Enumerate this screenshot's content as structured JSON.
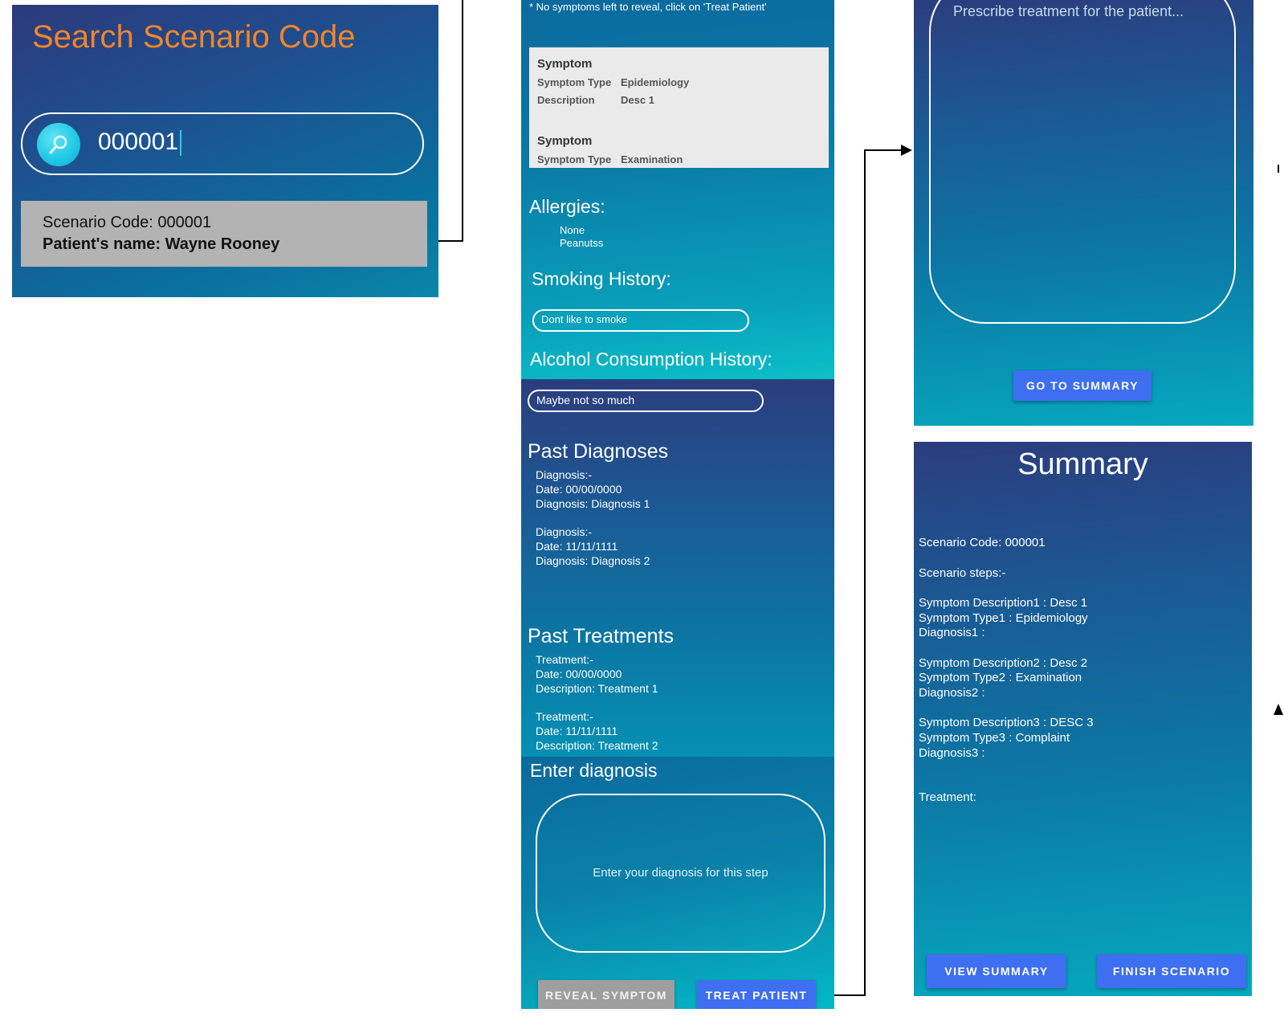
{
  "search_screen": {
    "title": "Search Scenario Code",
    "search_value": "000001",
    "result": {
      "code_line": "Scenario Code:  000001",
      "name_line": "Patient's name:  Wayne Rooney"
    }
  },
  "patient_screen": {
    "note": "* No symptoms left to reveal, click on 'Treat Patient'",
    "symptoms": [
      {
        "heading": "Symptom",
        "type_label": "Symptom Type",
        "type_value": "Epidemiology",
        "desc_label": "Description",
        "desc_value": "Desc 1"
      },
      {
        "heading": "Symptom",
        "type_label": "Symptom Type",
        "type_value": "Examination"
      }
    ],
    "allergies": {
      "heading": "Allergies:",
      "items": [
        "None",
        "Peanutss"
      ]
    },
    "smoking": {
      "heading": "Smoking History:",
      "value": "Dont like to smoke"
    },
    "alcohol": {
      "heading": "Alcohol Consumption History:",
      "value": "Maybe not so much"
    },
    "past_diagnoses": {
      "heading": "Past Diagnoses",
      "entries": [
        {
          "title": "Diagnosis:-",
          "date": "Date: 00/00/0000",
          "detail": "Diagnosis: Diagnosis 1"
        },
        {
          "title": "Diagnosis:-",
          "date": "Date: 11/11/1111",
          "detail": "Diagnosis: Diagnosis 2"
        }
      ]
    },
    "past_treatments": {
      "heading": "Past Treatments",
      "entries": [
        {
          "title": "Treatment:-",
          "date": "Date: 00/00/0000",
          "detail": "Description: Treatment 1"
        },
        {
          "title": "Treatment:-",
          "date": "Date: 11/11/1111",
          "detail": "Description: Treatment 2"
        }
      ]
    },
    "enter_diagnosis": {
      "heading": "Enter diagnosis",
      "placeholder": "Enter your diagnosis for this step"
    },
    "buttons": {
      "reveal": "REVEAL SYMPTOM",
      "treat": "TREAT PATIENT"
    }
  },
  "treatment_screen": {
    "placeholder": "Prescribe treatment for the patient...",
    "button": "GO TO SUMMARY"
  },
  "summary_screen": {
    "title": "Summary",
    "lines": [
      "Scenario Code: 000001",
      "Scenario steps:-",
      "Symptom Description1 : Desc 1",
      "Symptom Type1 : Epidemiology",
      "Diagnosis1 :",
      "Symptom Description2 : Desc 2",
      "Symptom Type2 : Examination",
      "Diagnosis2 :",
      "Symptom Description3 : DESC 3",
      "Symptom Type3 : Complaint",
      "Diagnosis3 :",
      "Treatment:"
    ],
    "buttons": {
      "view": "VIEW SUMMARY",
      "finish": "FINISH SCENARIO"
    }
  },
  "colors": {
    "title_orange": "#f0852a",
    "button_blue": "#3e6ff0",
    "button_grey": "#9e9e9e",
    "result_grey": "#b3b3b3",
    "symptom_box": "#eaeaea"
  }
}
